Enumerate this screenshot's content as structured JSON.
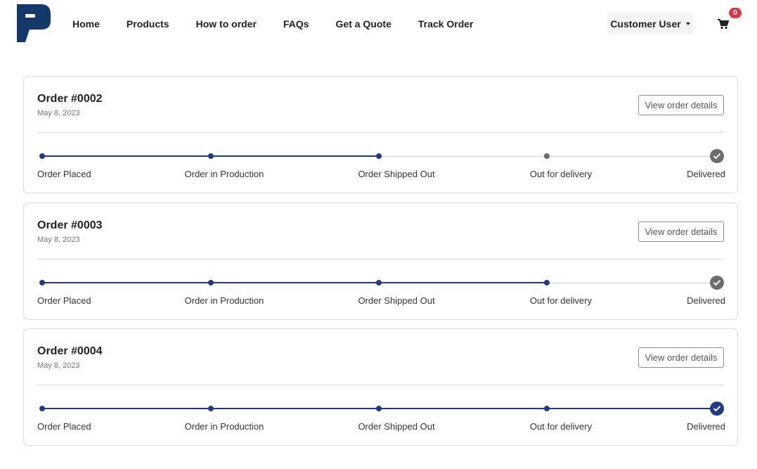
{
  "header": {
    "logo_icon": "brand-p-logo",
    "nav": [
      "Home",
      "Products",
      "How to order",
      "FAQs",
      "Get a Quote",
      "Track Order"
    ],
    "user_menu_label": "Customer User",
    "cart_icon": "shopping-cart-icon",
    "cart_count": "0"
  },
  "colors": {
    "accent": "#1f3a8a",
    "pending": "#6c6c6c",
    "badge": "#dc3545",
    "logo": "#13396b"
  },
  "orders": [
    {
      "title": "Order #0002",
      "date": "May 8, 2023",
      "button_label": "View order details",
      "completed_steps": 3,
      "steps": [
        "Order Placed",
        "Order in Production",
        "Order Shipped Out",
        "Out for delivery",
        "Delivered"
      ]
    },
    {
      "title": "Order #0003",
      "date": "May 8, 2023",
      "button_label": "View order details",
      "completed_steps": 4,
      "steps": [
        "Order Placed",
        "Order in Production",
        "Order Shipped Out",
        "Out for delivery",
        "Delivered"
      ]
    },
    {
      "title": "Order #0004",
      "date": "May 8, 2023",
      "button_label": "View order details",
      "completed_steps": 5,
      "steps": [
        "Order Placed",
        "Order in Production",
        "Order Shipped Out",
        "Out for delivery",
        "Delivered"
      ]
    }
  ]
}
